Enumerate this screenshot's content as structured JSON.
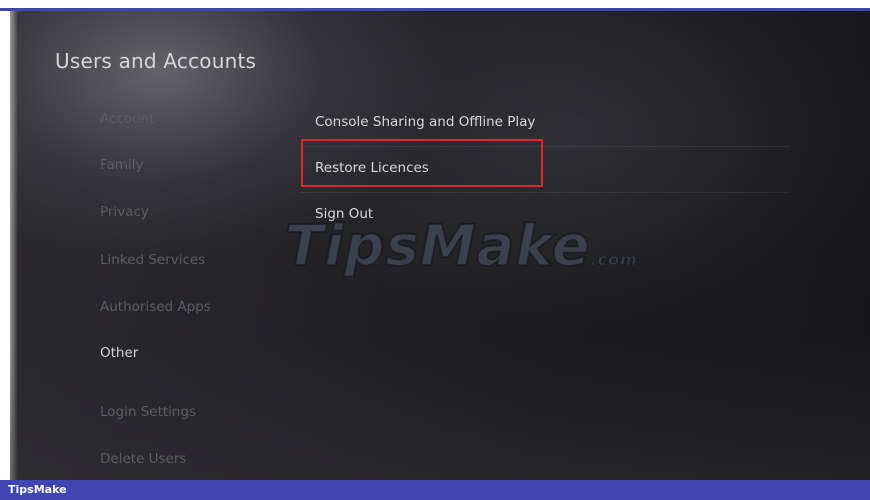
{
  "header": {
    "title": "Users and Accounts"
  },
  "sidebar": {
    "items": [
      {
        "label": "Account",
        "active": false
      },
      {
        "label": "Family",
        "active": false
      },
      {
        "label": "Privacy",
        "active": false
      },
      {
        "label": "Linked Services",
        "active": false
      },
      {
        "label": "Authorised Apps",
        "active": false
      },
      {
        "label": "Other",
        "active": true
      },
      {
        "label": "Login Settings",
        "active": false
      },
      {
        "label": "Delete Users",
        "active": false
      }
    ]
  },
  "main": {
    "items": [
      {
        "label": "Console Sharing and Offline Play"
      },
      {
        "label": "Restore Licences",
        "highlighted": true
      },
      {
        "label": "Sign Out"
      }
    ]
  },
  "watermark": {
    "text": "TipsMake",
    "suffix": ".com"
  },
  "footer": {
    "brand": "TipsMake"
  },
  "colors": {
    "accent_bar": "#3f46b3",
    "highlight_border": "#e1262b",
    "background": "#1d1c21"
  }
}
